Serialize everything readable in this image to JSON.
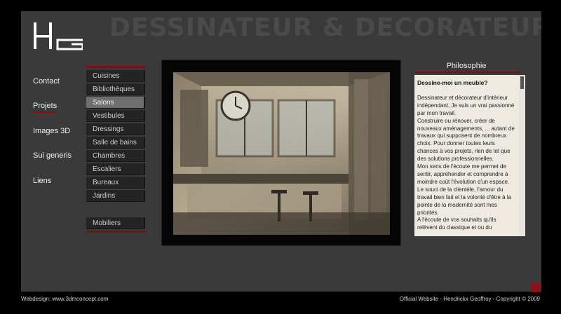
{
  "hero_title": "DESSINATEUR & DECORATEUR",
  "logo_text": "HG",
  "main_nav": [
    {
      "label": "Contact"
    },
    {
      "label": "Projets",
      "active": true
    },
    {
      "label": "Images 3D"
    },
    {
      "label": "Sui generis"
    },
    {
      "label": "Liens"
    }
  ],
  "sub_nav": [
    {
      "label": "Cuisines"
    },
    {
      "label": "Bibliothèques"
    },
    {
      "label": "Salons",
      "selected": true
    },
    {
      "label": "Vestibules"
    },
    {
      "label": "Dressings"
    },
    {
      "label": "Salle de bains"
    },
    {
      "label": "Chambres"
    },
    {
      "label": "Escaliers"
    },
    {
      "label": "Bureaux"
    },
    {
      "label": "Jardins"
    }
  ],
  "sub_nav_extra": {
    "label": "Mobiliers"
  },
  "philosophy": {
    "title": "Philosophie",
    "heading": "Dessine-moi un meuble?",
    "paragraphs": [
      "Dessinateur et décorateur d'intérieur indépendant, Je suis un vrai passionné par mon travail.",
      "Construire ou rénover, créer de nouveaux aménagements, ... autant de travaux qui supposent de nombreux choix. Pour donner toutes leurs chances à vos projets, rien de tel que des solutions professionnelles.",
      "Mon sens de l'écoute me permet de sentir, appréhender et comprendre à moindre coût l'évolution d'un espace. Le souci de la clientèle, l'amour du travail bien fait et la volonté d'être à la pointe de la modernité sont mes priorités.",
      "A l'écoute de vos souhaits qu'ils relèvent du classique et ou du"
    ]
  },
  "footer": {
    "left": "Webdesign: www.3dmconcept.com",
    "right": "Official Website - Hendrickx Geoffroy - Copyright © 2009"
  },
  "colors": {
    "accent": "#7a1010",
    "panel": "#3a3a3a",
    "selected": "#6e6e6e"
  }
}
